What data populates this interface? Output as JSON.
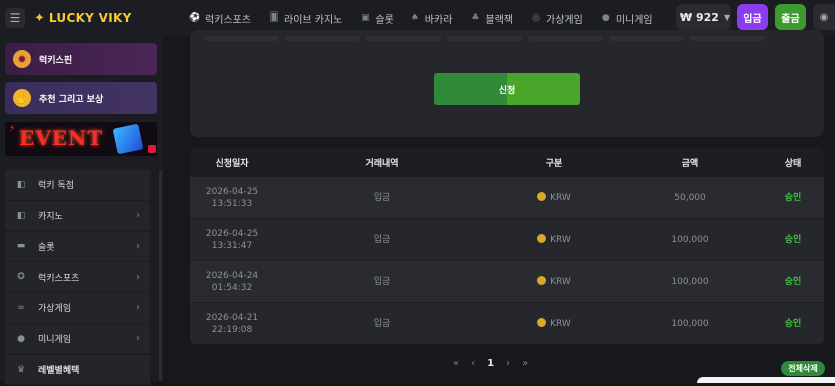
{
  "header": {
    "logo_mark": "✦",
    "logo_text": "LUCKY VIKY",
    "nav": [
      {
        "label": "럭키스포츠",
        "icon": "soccer-ball-icon",
        "glyph": "⚽"
      },
      {
        "label": "라이브 카지노",
        "icon": "cards-icon",
        "glyph": "🂠"
      },
      {
        "label": "슬롯",
        "icon": "slot-machine-icon",
        "glyph": "▣"
      },
      {
        "label": "바카라",
        "icon": "spade-icon",
        "glyph": "♠"
      },
      {
        "label": "블랙잭",
        "icon": "club-icon",
        "glyph": "♣"
      },
      {
        "label": "가상게임",
        "icon": "vr-goggles-icon",
        "glyph": "◎"
      },
      {
        "label": "미니게임",
        "icon": "globe-icon",
        "glyph": "●"
      }
    ],
    "balance": "₩ 922",
    "deposit_label": "입금",
    "withdraw_label": "출금"
  },
  "sidebar": {
    "promos": [
      {
        "label": "럭키스핀",
        "icon": "wheel-icon"
      },
      {
        "label": "추천 그리고 보상",
        "icon": "gift-hand-icon"
      }
    ],
    "event_banner": "EVENT",
    "items": [
      {
        "label": "럭키 독점",
        "icon": "star-card-icon",
        "chevron": false
      },
      {
        "label": "카지노",
        "icon": "cards-icon",
        "chevron": true
      },
      {
        "label": "슬롯",
        "icon": "slot-machine-icon",
        "chevron": true
      },
      {
        "label": "럭키스포츠",
        "icon": "soccer-ball-icon",
        "chevron": true
      },
      {
        "label": "가상게임",
        "icon": "vr-goggles-icon",
        "chevron": true
      },
      {
        "label": "미니게임",
        "icon": "globe-icon",
        "chevron": true
      },
      {
        "label": "레벨별혜택",
        "icon": "crown-icon",
        "chevron": false
      }
    ]
  },
  "main": {
    "apply_label": "신청",
    "table": {
      "columns": [
        "신청일자",
        "거래내역",
        "구분",
        "금액",
        "상태"
      ],
      "rows": [
        {
          "date": "2026-04-25",
          "time": "13:51:33",
          "type": "입금",
          "currency": "KRW",
          "amount": "50,000",
          "status": "승인"
        },
        {
          "date": "2026-04-25",
          "time": "13:31:47",
          "type": "입금",
          "currency": "KRW",
          "amount": "100,000",
          "status": "승인"
        },
        {
          "date": "2026-04-24",
          "time": "01:54:32",
          "type": "입금",
          "currency": "KRW",
          "amount": "100,000",
          "status": "승인"
        },
        {
          "date": "2026-04-21",
          "time": "22:19:08",
          "type": "입금",
          "currency": "KRW",
          "amount": "100,000",
          "status": "승인"
        }
      ]
    },
    "pager": {
      "first": "«",
      "prev": "‹",
      "current": "1",
      "next": "›",
      "last": "»"
    },
    "delete_all_label": "전체삭제"
  }
}
